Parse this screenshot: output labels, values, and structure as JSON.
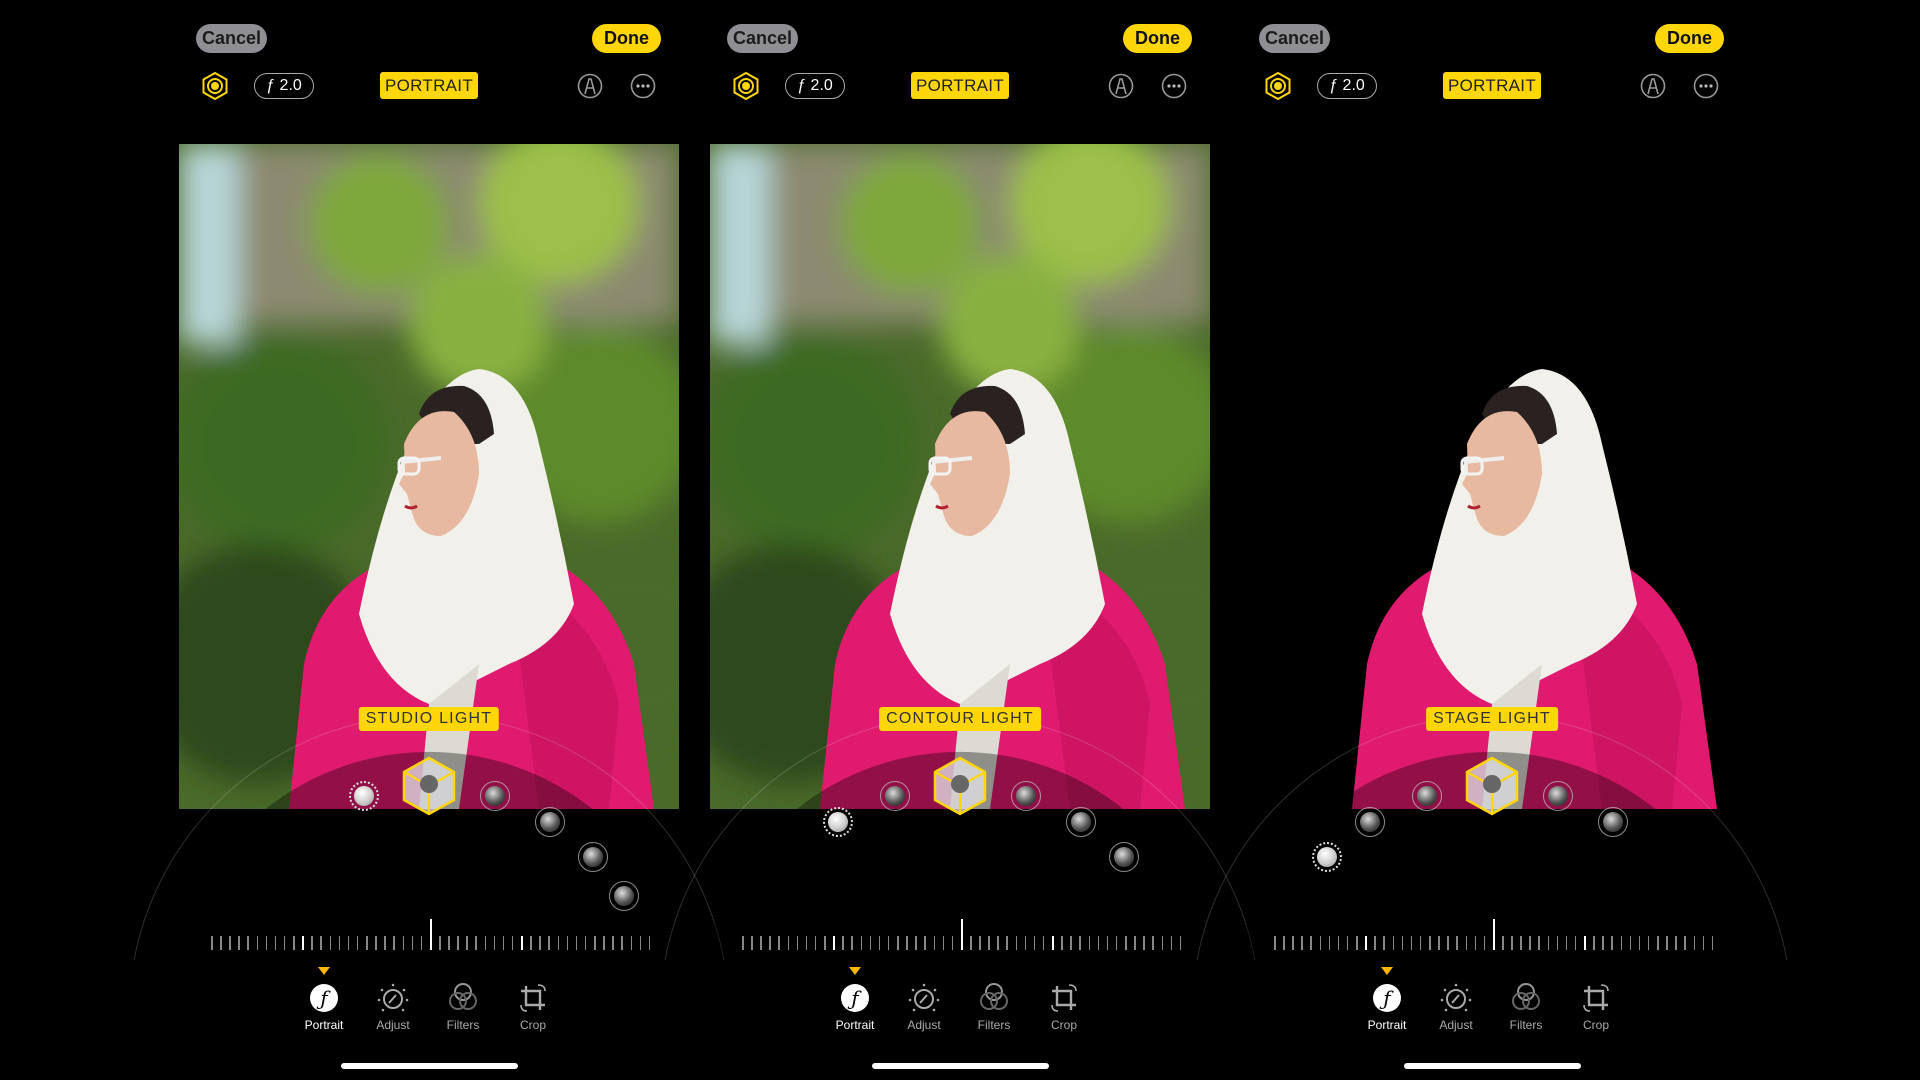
{
  "colors": {
    "accent": "#ffd60a",
    "cancel_bg": "#8e8e93",
    "tab_indicator": "#ffb800"
  },
  "panels": [
    {
      "cancel_label": "Cancel",
      "done_label": "Done",
      "aperture_label": "ƒ 2.0",
      "mode_badge": "PORTRAIT",
      "light_label": "STUDIO LIGHT",
      "selected_light_index": 1,
      "background": "blurred-greenery",
      "tools": [
        {
          "label": "Portrait",
          "icon": "portrait-f-icon"
        },
        {
          "label": "Adjust",
          "icon": "adjust-dial-icon"
        },
        {
          "label": "Filters",
          "icon": "filters-circles-icon"
        },
        {
          "label": "Crop",
          "icon": "crop-rotate-icon"
        }
      ],
      "active_tool": "Portrait"
    },
    {
      "cancel_label": "Cancel",
      "done_label": "Done",
      "aperture_label": "ƒ 2.0",
      "mode_badge": "PORTRAIT",
      "light_label": "CONTOUR LIGHT",
      "selected_light_index": 2,
      "background": "blurred-greenery",
      "tools": [
        {
          "label": "Portrait",
          "icon": "portrait-f-icon"
        },
        {
          "label": "Adjust",
          "icon": "adjust-dial-icon"
        },
        {
          "label": "Filters",
          "icon": "filters-circles-icon"
        },
        {
          "label": "Crop",
          "icon": "crop-rotate-icon"
        }
      ],
      "active_tool": "Portrait"
    },
    {
      "cancel_label": "Cancel",
      "done_label": "Done",
      "aperture_label": "ƒ 2.0",
      "mode_badge": "PORTRAIT",
      "light_label": "STAGE LIGHT",
      "selected_light_index": 3,
      "background": "black",
      "tools": [
        {
          "label": "Portrait",
          "icon": "portrait-f-icon"
        },
        {
          "label": "Adjust",
          "icon": "adjust-dial-icon"
        },
        {
          "label": "Filters",
          "icon": "filters-circles-icon"
        },
        {
          "label": "Crop",
          "icon": "crop-rotate-icon"
        }
      ],
      "active_tool": "Portrait"
    }
  ],
  "light_count": 6
}
